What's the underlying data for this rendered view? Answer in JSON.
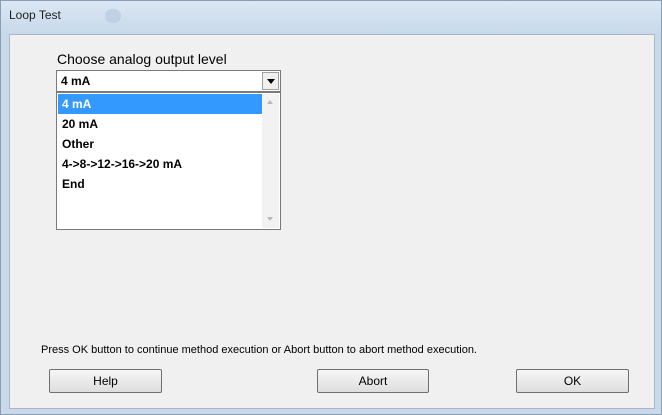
{
  "window": {
    "title": "Loop Test"
  },
  "form": {
    "prompt": "Choose analog output level",
    "selected_value": "4 mA",
    "options": [
      "4 mA",
      "20 mA",
      "Other",
      "4->8->12->16->20 mA",
      "End"
    ]
  },
  "message": "Press OK button to continue method execution or Abort button to abort method execution.",
  "buttons": {
    "help": "Help",
    "abort": "Abort",
    "ok": "OK"
  },
  "colors": {
    "selection": "#3399ff",
    "dialog_frame": "#c9d9ea",
    "client_bg": "#f0f0f0"
  }
}
